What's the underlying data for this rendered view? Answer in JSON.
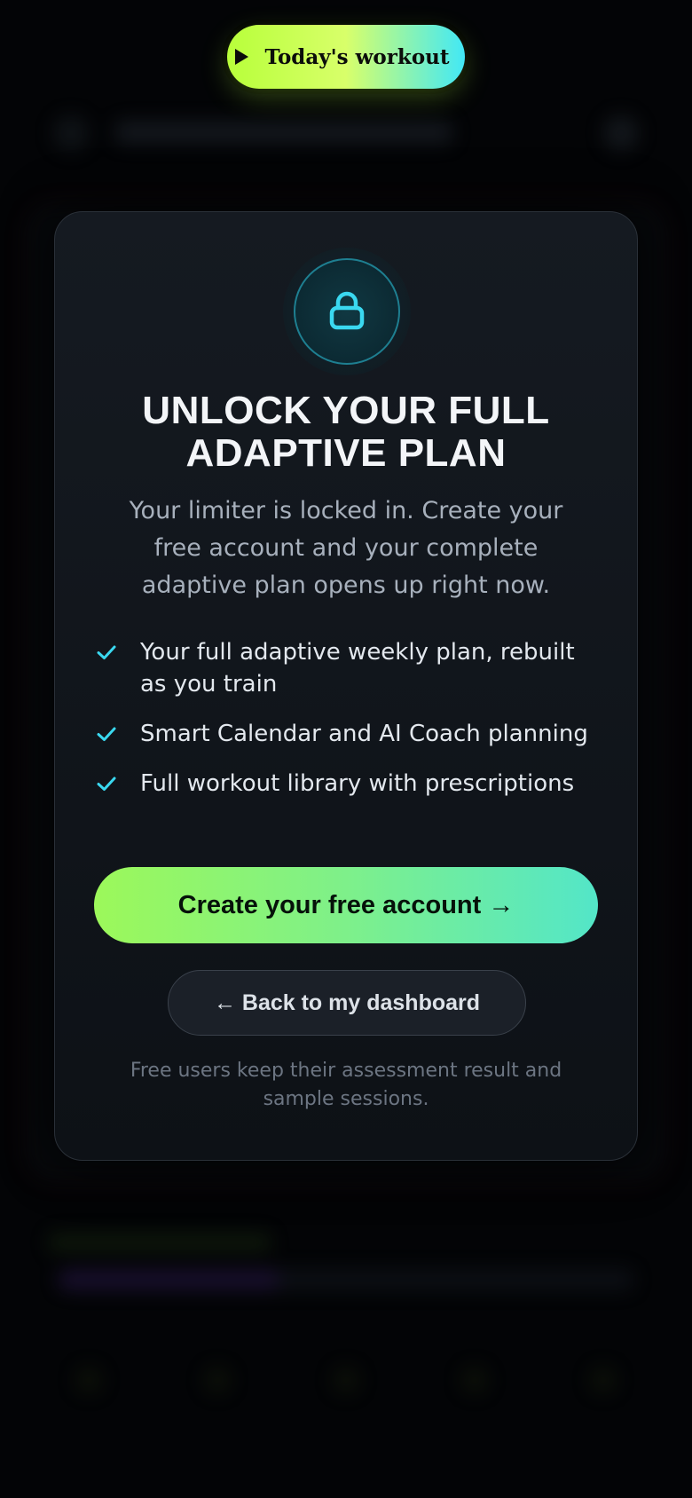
{
  "top_pill": {
    "label": "Today's workout",
    "icon": "play-icon"
  },
  "modal": {
    "icon": "lock-icon",
    "title_line1": "UNLOCK YOUR FULL",
    "title_line2": "ADAPTIVE PLAN",
    "subtitle": "Your limiter is locked in. Create your free account and your complete adaptive plan opens up right now.",
    "features": [
      "Your full adaptive weekly plan, rebuilt as you train",
      "Smart Calendar and AI Coach planning",
      "Full workout library with prescriptions"
    ],
    "primary_cta": "Create your free account →",
    "secondary_cta": "← Back to my dashboard",
    "footnote": "Free users keep their assessment result and sample sessions."
  },
  "colors": {
    "accent_lime": "#b8ff3a",
    "accent_cyan": "#42e8f6",
    "check_color": "#3ad8f0",
    "card_bg": "#12171d"
  }
}
